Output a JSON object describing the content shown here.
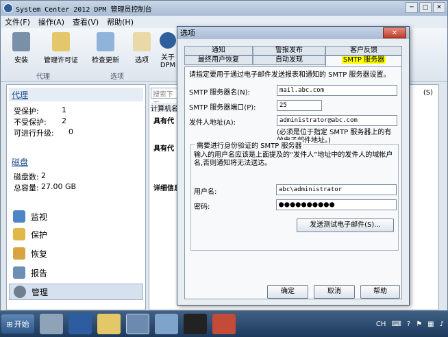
{
  "window": {
    "title": "System Center 2012 DPM 管理员控制台"
  },
  "menu": [
    "文件(F)",
    "操作(A)",
    "查看(V)",
    "帮助(H)"
  ],
  "ribbon": {
    "buttons": [
      "安装",
      "管理许可证",
      "检查更新",
      "选项",
      "关于 DPM"
    ],
    "groups": [
      "代理",
      "选项"
    ]
  },
  "leftpane": {
    "agent": {
      "title": "代理",
      "rows": [
        {
          "k": "受保护:",
          "v": "1"
        },
        {
          "k": "不受保护:",
          "v": "2"
        },
        {
          "k": "可进行升级:",
          "v": "0"
        }
      ]
    },
    "disk": {
      "title": "磁盘",
      "rows": [
        {
          "k": "磁盘数:",
          "v": "2"
        },
        {
          "k": "总容量:",
          "v": "27.00 GB"
        }
      ]
    },
    "nav": [
      "监视",
      "保护",
      "恢复",
      "报告",
      "管理"
    ]
  },
  "rightpane": {
    "search_placeholder": "搜索下面",
    "col": "计算机名",
    "groups": [
      "具有代",
      "具有代"
    ],
    "detail": "详细信息",
    "side_right": "(S)"
  },
  "dialog": {
    "title": "选项",
    "close": "✕",
    "tabs": [
      "通知",
      "警报发布",
      "客户反馈",
      "最终用户恢复",
      "自动发现",
      "SMTP 服务器"
    ],
    "intro": "请指定要用于通过电子邮件发送报表和通知的 SMTP 服务器设置。",
    "server_label": "SMTP 服务器名(N):",
    "server_value": "mail.abc.com",
    "port_label": "SMTP 服务器端口(P):",
    "port_value": "25",
    "from_label": "发件人地址(A):",
    "from_value": "administrator@abc.com",
    "from_note": "(必须是位于指定 SMTP 服务器上的有效电子邮件地址。)",
    "auth_group": "需要进行身份验证的 SMTP 服务器",
    "auth_desc": "输入的用户名应该是上面提及的“发件人”地址中的发件人的域帐户名,否则通知将无法送达。",
    "user_label": "用户名:",
    "user_value": "abc\\administrator",
    "pwd_label": "密码:",
    "pwd_value": "●●●●●●●●●●",
    "test_button": "发送测试电子邮件(S)...",
    "ok": "确定",
    "cancel": "取消",
    "help": "帮助"
  },
  "taskbar": {
    "start": "开始",
    "lang": "CH"
  }
}
